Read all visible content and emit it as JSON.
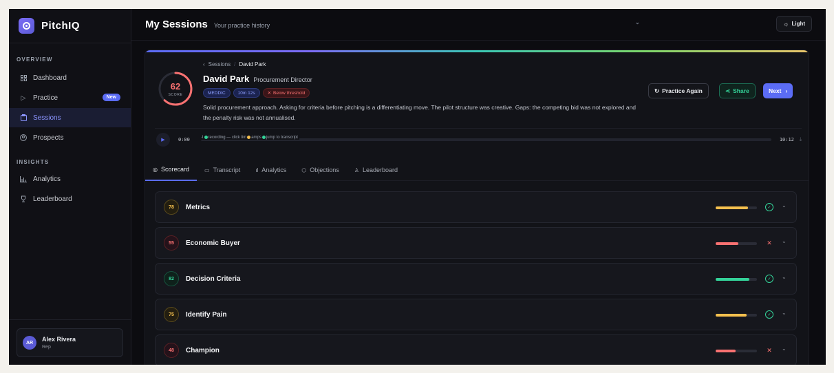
{
  "app": {
    "name": "PitchIQ"
  },
  "sidebar": {
    "sections": [
      {
        "label": "OVERVIEW",
        "items": [
          {
            "label": "Dashboard",
            "icon": "grid-icon"
          },
          {
            "label": "Practice",
            "icon": "play-icon",
            "badge": "New"
          },
          {
            "label": "Sessions",
            "icon": "clipboard-icon",
            "active": true
          },
          {
            "label": "Prospects",
            "icon": "user-circle-icon"
          }
        ]
      },
      {
        "label": "INSIGHTS",
        "items": [
          {
            "label": "Analytics",
            "icon": "bar-chart-icon"
          },
          {
            "label": "Leaderboard",
            "icon": "trophy-icon"
          }
        ]
      }
    ],
    "user": {
      "initials": "AR",
      "name": "Alex Rivera",
      "role": "Rep"
    }
  },
  "header": {
    "title": "My Sessions",
    "subtitle": "Your practice history",
    "theme_toggle": "Light"
  },
  "session": {
    "score": "62",
    "score_label": "SCORE",
    "breadcrumb": [
      "Sessions",
      "David Park"
    ],
    "name": "David Park",
    "role": "Procurement Director",
    "tags": [
      "MEDDIC",
      "10m 12s",
      "Below threshold"
    ],
    "summary": "Solid procurement approach. Asking for criteria before pitching is a differentiating move. The pilot structure was creative. Gaps: the competing bid was not explored and the penalty risk was not annualised.",
    "actions": {
      "practice_again": "Practice Again",
      "share": "Share",
      "next": "Next"
    }
  },
  "player": {
    "current_time": "0:00",
    "duration": "10:12",
    "track_text_1": "recording — click tim",
    "track_text_2": "amps",
    "track_text_3": "jump to transcript"
  },
  "tabs": [
    "Scorecard",
    "Transcript",
    "Analytics",
    "Objections",
    "Leaderboard"
  ],
  "scorecard": [
    {
      "score": "78",
      "label": "Metrics",
      "progress": 0.78,
      "status": "pass",
      "tone": "y",
      "color": "#f5c04e"
    },
    {
      "score": "55",
      "label": "Economic Buyer",
      "progress": 0.55,
      "status": "fail",
      "tone": "r",
      "color": "#f87171"
    },
    {
      "score": "82",
      "label": "Decision Criteria",
      "progress": 0.82,
      "status": "pass",
      "tone": "g",
      "color": "#34d399"
    },
    {
      "score": "75",
      "label": "Identify Pain",
      "progress": 0.75,
      "status": "pass",
      "tone": "y",
      "color": "#f5c04e"
    },
    {
      "score": "48",
      "label": "Champion",
      "progress": 0.48,
      "status": "fail",
      "tone": "r",
      "color": "#f87171"
    }
  ]
}
